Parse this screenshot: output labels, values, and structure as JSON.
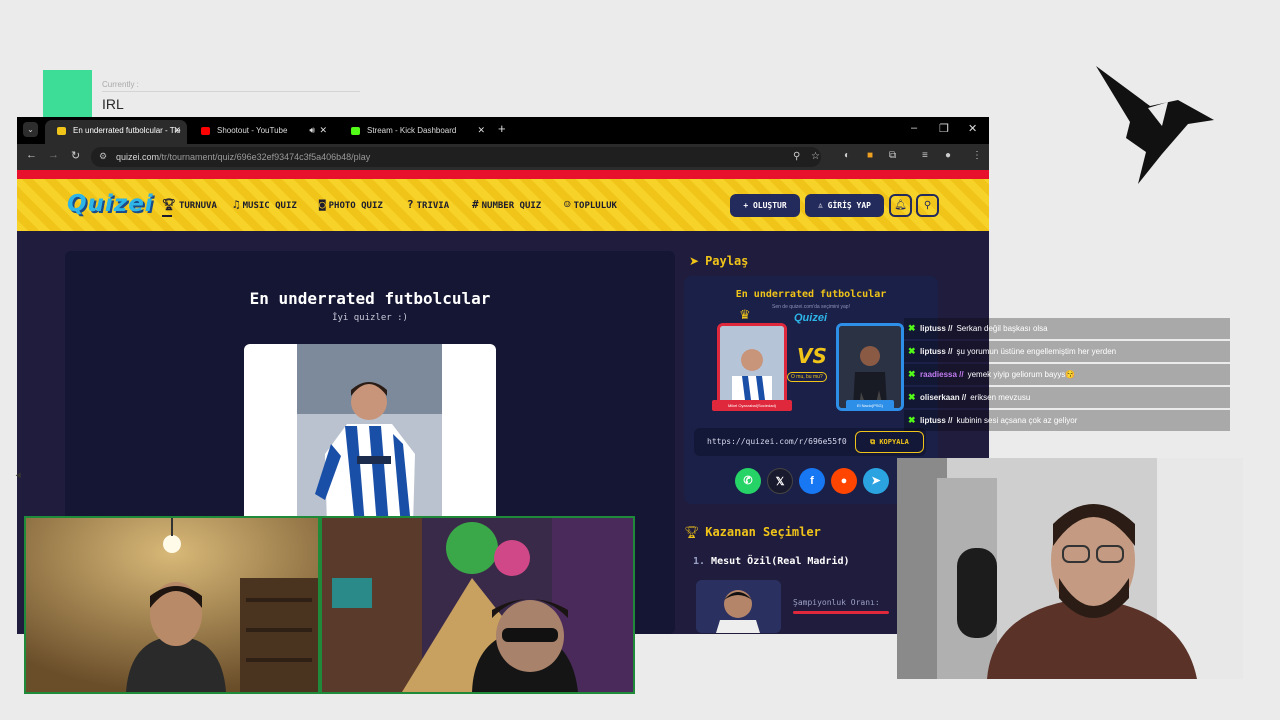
{
  "overlay": {
    "status_caption": "Currently :",
    "status_value": "IRL",
    "accent_color": "#3ddc97",
    "logo_icon": "bird-logo-icon"
  },
  "browser": {
    "tabs": [
      {
        "label": "En underrated futbolcular - Tie",
        "active": true
      },
      {
        "label": "Shootout - YouTube",
        "active": false
      },
      {
        "label": "Stream - Kick Dashboard",
        "active": false
      }
    ],
    "url_host": "quizei.com",
    "url_path": "/tr/tournament/quiz/696e32ef93474c3f5a406b48/play"
  },
  "site": {
    "logo_text": "Quizei",
    "nav": [
      {
        "label": "TURNUVA",
        "icon": "trophy-icon"
      },
      {
        "label": "MUSIC QUIZ",
        "icon": "music-icon"
      },
      {
        "label": "PHOTO QUIZ",
        "icon": "camera-icon"
      },
      {
        "label": "TRIVIA",
        "icon": "question-icon"
      },
      {
        "label": "NUMBER QUIZ",
        "icon": "hash-icon"
      },
      {
        "label": "TOPLULUK",
        "icon": "users-icon"
      }
    ],
    "create_label": "+ OLUŞTUR",
    "login_label": "GİRİŞ YAP",
    "brand_yellow": "#f0c419",
    "brand_red": "#e8112d"
  },
  "quiz": {
    "title": "En underrated futbolcular",
    "subtitle": "İyi quizler :)"
  },
  "share": {
    "heading": "Paylaş",
    "card_title": "En underrated futbolcular",
    "card_sub": "Sen de quizei.com'da seçimini yap!",
    "vs_logo": "Quizei",
    "vs_text": "VS",
    "vs_question": "O mu, bu mu?",
    "left_name": "Mikel Oyarzabal(Sociedad)",
    "right_name": "El Nacio(PSG)",
    "link": "https://quizei.com/r/696e55f0",
    "copy_label": "KOPYALA"
  },
  "winners": {
    "heading": "Kazanan Seçimler",
    "items": [
      {
        "rank": "1.",
        "name": "Mesut Özil(Real Madrid)",
        "rate_label": "Şampiyonluk Oranı:"
      }
    ]
  },
  "chat": [
    {
      "user": "liptuss",
      "color": "#f2f2f2",
      "text": "Serkan değil başkası olsa"
    },
    {
      "user": "liptuss",
      "color": "#f2f2f2",
      "text": "şu yorumun üstüne engellemiştim her yerden"
    },
    {
      "user": "raadiessa",
      "color": "#c27cf0",
      "text": "yemek yiyip geliorum bayys😚"
    },
    {
      "user": "oliserkaan",
      "color": "#f2f2f2",
      "text": "eriksen mevzusu"
    },
    {
      "user": "liptuss",
      "color": "#f2f2f2",
      "text": "kubinin sesi açsana çok az geliyor"
    }
  ]
}
